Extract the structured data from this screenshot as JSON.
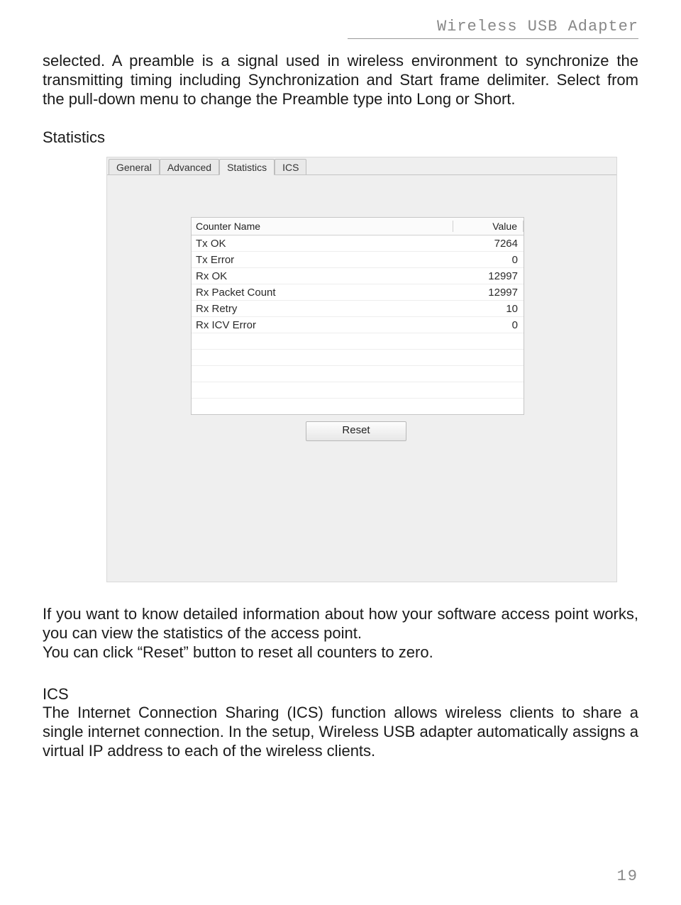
{
  "header": {
    "running_title": "Wireless USB Adapter"
  },
  "paragraphs": {
    "p1": "selected. A preamble is a signal used in wireless environment to synchronize the transmitting timing including Synchronization and Start frame delimiter. Select from the pull-down menu to change the Preamble type into Long or Short.",
    "statistics_heading": "Statistics",
    "p2": "If you want to know detailed information about how your software access point works, you can view the statistics of the access point.",
    "p3": "You can click “Reset” button to reset all counters to zero.",
    "ics_heading": "ICS",
    "p4": "The Internet Connection Sharing (ICS) function allows wireless clients to share a single internet connection. In the setup, Wireless USB adapter automatically assigns a virtual IP address to each of the wireless clients."
  },
  "screenshot": {
    "tabs": {
      "general": "General",
      "advanced": "Advanced",
      "statistics": "Statistics",
      "ics": "ICS"
    },
    "table": {
      "header_name": "Counter Name",
      "header_value": "Value",
      "rows": [
        {
          "name": "Tx OK",
          "value": "7264"
        },
        {
          "name": "Tx Error",
          "value": "0"
        },
        {
          "name": "Rx OK",
          "value": "12997"
        },
        {
          "name": "Rx Packet Count",
          "value": "12997"
        },
        {
          "name": "Rx Retry",
          "value": "10"
        },
        {
          "name": "Rx ICV Error",
          "value": "0"
        }
      ]
    },
    "reset_label": "Reset"
  },
  "page_number": "19"
}
